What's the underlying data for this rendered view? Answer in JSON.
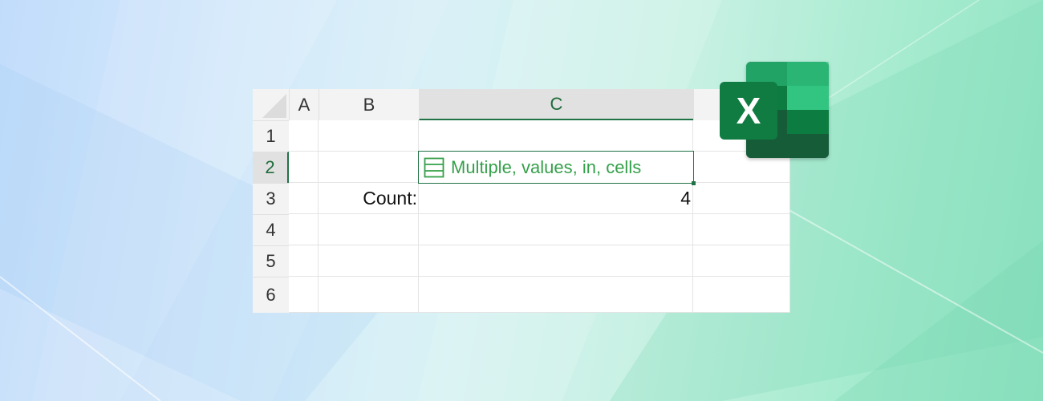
{
  "spreadsheet": {
    "columns": [
      "A",
      "B",
      "C"
    ],
    "rows": [
      "1",
      "2",
      "3",
      "4",
      "5",
      "6"
    ],
    "selected_column": "C",
    "selected_row": "2",
    "cells": {
      "C2": "Multiple, values, in, cells",
      "B3": "Count:",
      "C3": "4"
    }
  },
  "icons": {
    "cell_type": "array-rows-icon",
    "app_logo": "excel-logo-icon"
  },
  "logo": {
    "letter": "X"
  },
  "colors": {
    "excel_green": "#217346",
    "value_green": "#34a04a"
  }
}
